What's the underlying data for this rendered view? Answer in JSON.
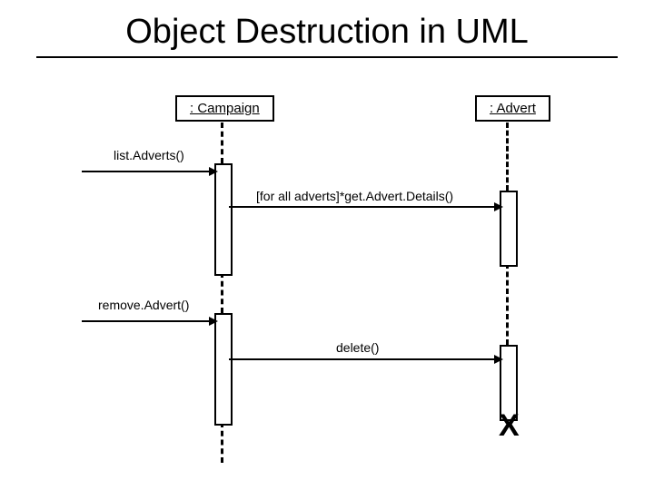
{
  "title": "Object Destruction in UML",
  "objects": {
    "left": {
      "label": ": Campaign"
    },
    "right": {
      "label": ": Advert"
    }
  },
  "messages": {
    "listAdverts": "list.Adverts()",
    "getAdvertDetails": "[for all adverts]*get.Advert.Details()",
    "removeAdvert": "remove.Advert()",
    "delete": "delete()"
  },
  "destroyMark": "X"
}
